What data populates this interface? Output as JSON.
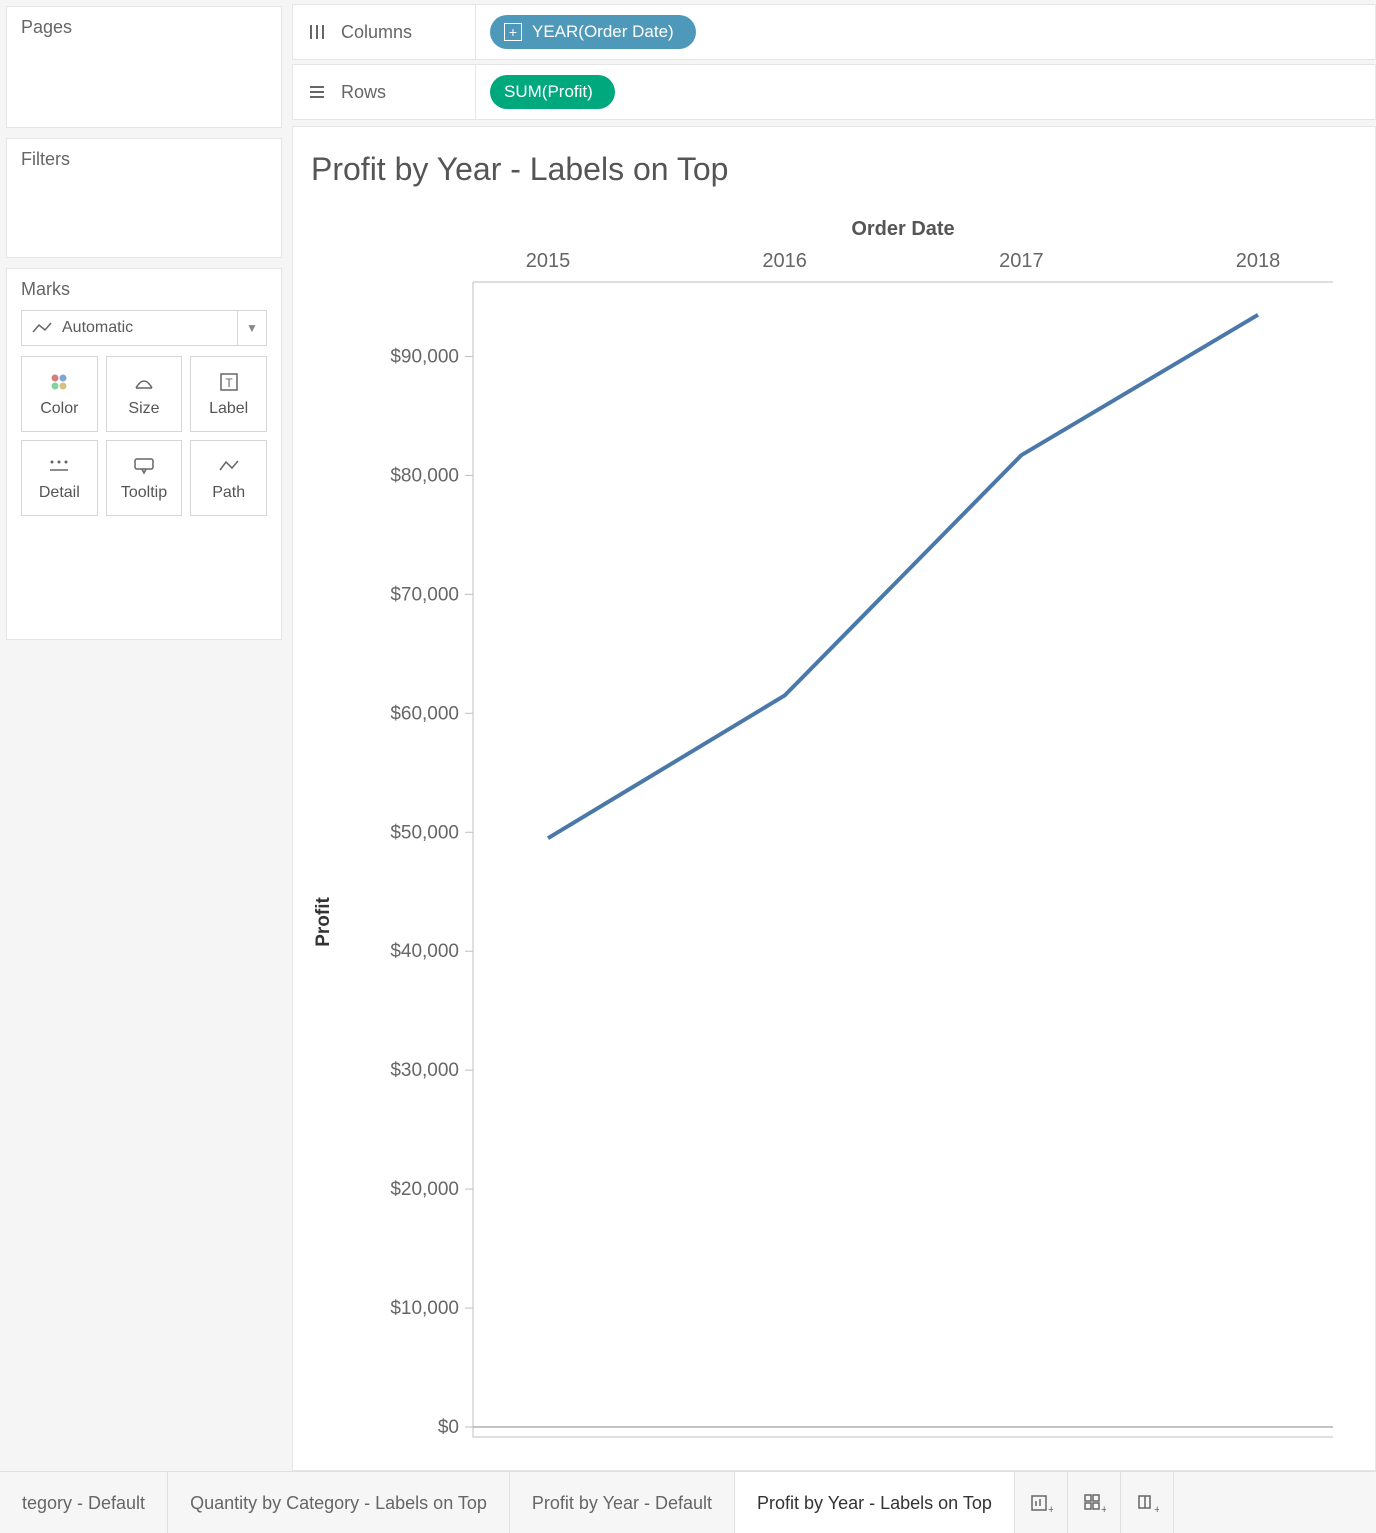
{
  "left": {
    "pages": {
      "title": "Pages"
    },
    "filters": {
      "title": "Filters"
    },
    "marks": {
      "title": "Marks",
      "type_label": "Automatic",
      "buttons": [
        {
          "label": "Color"
        },
        {
          "label": "Size"
        },
        {
          "label": "Label"
        },
        {
          "label": "Detail"
        },
        {
          "label": "Tooltip"
        },
        {
          "label": "Path"
        }
      ]
    }
  },
  "shelves": {
    "columns": {
      "label": "Columns",
      "pill": "YEAR(Order Date)"
    },
    "rows": {
      "label": "Rows",
      "pill": "SUM(Profit)"
    }
  },
  "viz": {
    "title": "Profit by Year - Labels on Top",
    "x_title": "Order Date",
    "y_title": "Profit"
  },
  "chart_data": {
    "type": "line",
    "title": "Profit by Year - Labels on Top",
    "x_title": "Order Date",
    "y_title": "Profit",
    "categories": [
      "2015",
      "2016",
      "2017",
      "2018"
    ],
    "values": [
      49500,
      61500,
      81700,
      93500
    ],
    "y_ticks": [
      "$0",
      "$10,000",
      "$20,000",
      "$30,000",
      "$40,000",
      "$50,000",
      "$60,000",
      "$70,000",
      "$80,000",
      "$90,000"
    ],
    "ylim": [
      0,
      95000
    ],
    "line_color": "#4a78a8"
  },
  "tabs": {
    "items": [
      {
        "label": "tegory - Default",
        "active": false
      },
      {
        "label": "Quantity by Category - Labels on Top",
        "active": false
      },
      {
        "label": "Profit by Year - Default",
        "active": false
      },
      {
        "label": "Profit by Year - Labels on Top",
        "active": true
      }
    ]
  }
}
